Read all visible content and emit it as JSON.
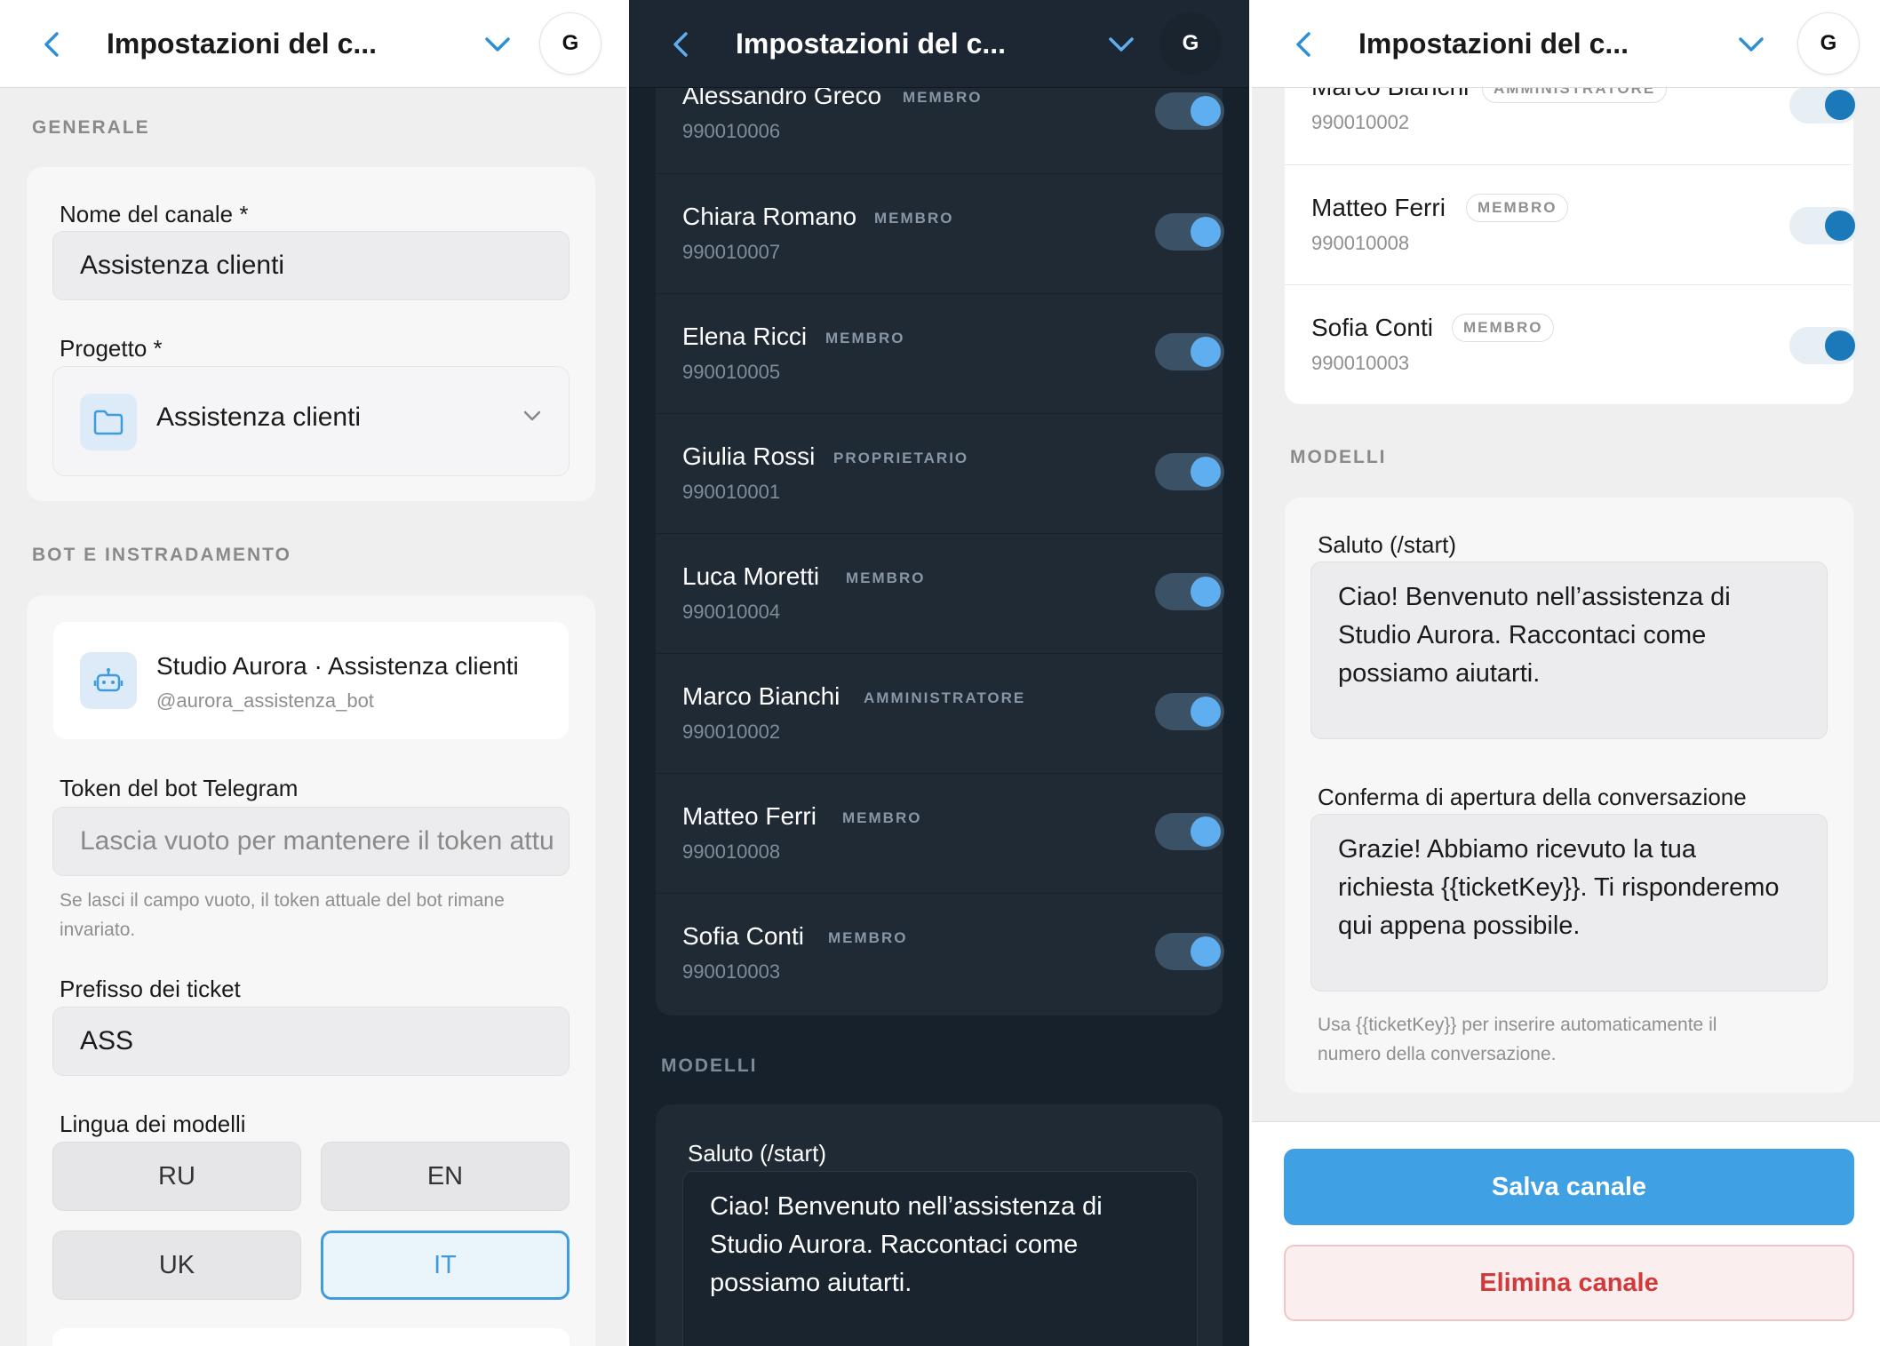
{
  "header": {
    "title": "Impostazioni del c...",
    "avatar_letter": "G"
  },
  "general": {
    "section_label": "GENERALE",
    "channel_name_label": "Nome del canale *",
    "channel_name_value": "Assistenza clienti",
    "project_label": "Progetto *",
    "project_value": "Assistenza clienti"
  },
  "bot": {
    "section_label": "BOT E INSTRADAMENTO",
    "bot_name": "Studio Aurora · Assistenza clienti",
    "bot_handle": "@aurora_assistenza_bot",
    "token_label": "Token del bot Telegram",
    "token_placeholder": "Lascia vuoto per mantenere il token attu",
    "token_hint_line1": "Se lasci il campo vuoto, il token attuale del bot rimane",
    "token_hint_line2": "invariato.",
    "prefix_label": "Prefisso dei ticket",
    "prefix_value": "ASS",
    "lang_label": "Lingua dei modelli",
    "langs": [
      "RU",
      "EN",
      "UK",
      "IT"
    ],
    "active_lang": "IT"
  },
  "members": [
    {
      "name": "Alessandro Greco",
      "role": "MEMBRO",
      "id": "990010006",
      "enabled": true
    },
    {
      "name": "Chiara Romano",
      "role": "MEMBRO",
      "id": "990010007",
      "enabled": true
    },
    {
      "name": "Elena Ricci",
      "role": "MEMBRO",
      "id": "990010005",
      "enabled": true
    },
    {
      "name": "Giulia Rossi",
      "role": "PROPRIETARIO",
      "id": "990010001",
      "enabled": true
    },
    {
      "name": "Luca Moretti",
      "role": "MEMBRO",
      "id": "990010004",
      "enabled": true
    },
    {
      "name": "Marco Bianchi",
      "role": "AMMINISTRATORE",
      "id": "990010002",
      "enabled": true
    },
    {
      "name": "Matteo Ferri",
      "role": "MEMBRO",
      "id": "990010008",
      "enabled": true
    },
    {
      "name": "Sofia Conti",
      "role": "MEMBRO",
      "id": "990010003",
      "enabled": true
    }
  ],
  "templates": {
    "section_label": "MODELLI",
    "greeting_label": "Saluto (/start)",
    "greeting_line1": "Ciao! Benvenuto nell’assistenza di",
    "greeting_line2": "Studio Aurora. Raccontaci come",
    "greeting_line3": "possiamo aiutarti.",
    "confirm_label": "Conferma di apertura della conversazione",
    "confirm_line1": "Grazie! Abbiamo ricevuto la tua",
    "confirm_line2": "richiesta {{ticketKey}}. Ti risponderemo",
    "confirm_line3": "qui appena possibile.",
    "hint_line1": "Usa {{ticketKey}} per inserire automaticamente il",
    "hint_line2": "numero della conversazione."
  },
  "actions": {
    "save": "Salva canale",
    "delete": "Elimina canale"
  },
  "colors": {
    "accent": "#3fa1e3",
    "danger": "#cf3a3a",
    "dark_bg": "#17212b",
    "toggle_on_light": "#1b79b9",
    "toggle_on_dark": "#5eaef0"
  },
  "icons": [
    "back-arrow-icon",
    "chevron-down-icon",
    "folder-icon",
    "robot-icon"
  ]
}
